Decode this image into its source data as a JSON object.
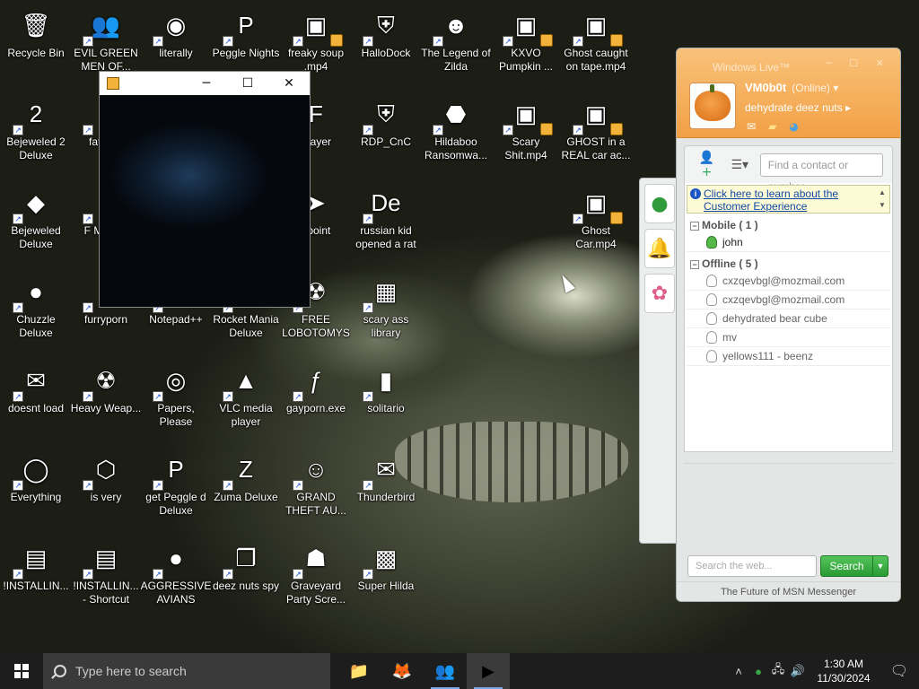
{
  "desktop": {
    "icons": [
      {
        "label": "Recycle Bin",
        "glyph": "🗑"
      },
      {
        "label": "EVIL GREEN MEN OF...",
        "glyph": "👥"
      },
      {
        "label": "literally",
        "glyph": "◉"
      },
      {
        "label": "Peggle Nights",
        "glyph": "P"
      },
      {
        "label": "freaky soup .mp4",
        "glyph": "▣"
      },
      {
        "label": "HalloDock",
        "glyph": "⛨"
      },
      {
        "label": "The Legend of Zilda",
        "glyph": "☻"
      },
      {
        "label": "KXVO Pumpkin ...",
        "glyph": "▣"
      },
      {
        "label": "Ghost caught on tape.mp4",
        "glyph": "▣"
      },
      {
        "label": "Bejeweled 2 Deluxe",
        "glyph": "2"
      },
      {
        "label": "fat lik...",
        "glyph": "▲"
      },
      {
        "label": "Player",
        "glyph": "F"
      },
      {
        "label": "RDP_CnC",
        "glyph": "⛨"
      },
      {
        "label": "Hildaboo Ransomwa...",
        "glyph": "⬣"
      },
      {
        "label": "Scary Shit.mp4",
        "glyph": "▣"
      },
      {
        "label": "GHOST in a REAL car ac...",
        "glyph": "▣"
      },
      {
        "label": "Bejeweled Deluxe",
        "glyph": "◆"
      },
      {
        "label": "F MON...",
        "glyph": "◐"
      },
      {
        "label": "npoint",
        "glyph": "➤"
      },
      {
        "label": "russian kid opened a rat",
        "glyph": "De"
      },
      {
        "label": "Ghost Car.mp4",
        "glyph": "▣"
      },
      {
        "label": "Chuzzle Deluxe",
        "glyph": "●"
      },
      {
        "label": "furryporn",
        "glyph": "◕"
      },
      {
        "label": "Notepad++",
        "glyph": "✎"
      },
      {
        "label": "Rocket Mania Deluxe",
        "glyph": "✹"
      },
      {
        "label": "FREE LOBOTOMYS",
        "glyph": "☢"
      },
      {
        "label": "scary ass library",
        "glyph": "▦"
      },
      {
        "label": "doesnt load",
        "glyph": "✉"
      },
      {
        "label": "Heavy Weap...",
        "glyph": "☢"
      },
      {
        "label": "Papers, Please",
        "glyph": "◎"
      },
      {
        "label": "VLC media player",
        "glyph": "▲"
      },
      {
        "label": "gayporn.exe",
        "glyph": "ƒ"
      },
      {
        "label": "solitario",
        "glyph": "▮"
      },
      {
        "label": "Everything",
        "glyph": "◯"
      },
      {
        "label": "is very",
        "glyph": "⬡"
      },
      {
        "label": "get Peggle d Deluxe",
        "glyph": "P"
      },
      {
        "label": "Zuma Deluxe",
        "glyph": "Z"
      },
      {
        "label": "GRAND THEFT AU...",
        "glyph": "☺"
      },
      {
        "label": "Thunderbird",
        "glyph": "✉"
      },
      {
        "label": "!INSTALLIN...",
        "glyph": "▤"
      },
      {
        "label": "!INSTALLIN... - Shortcut",
        "glyph": "▤"
      },
      {
        "label": "AGGRESSIVE AVIANS",
        "glyph": "●"
      },
      {
        "label": "deez nuts spy",
        "glyph": "❐"
      },
      {
        "label": "Graveyard Party Scre...",
        "glyph": "☗"
      },
      {
        "label": "Super Hilda",
        "glyph": "▩"
      }
    ]
  },
  "media_window": {
    "minimize": "─",
    "maximize": "☐",
    "close": "✕"
  },
  "msn": {
    "title": "Windows Live™",
    "window_buttons": "─ ☐ ✕",
    "display_name": "VM0b0t",
    "status": "(Online) ▾",
    "personal_message": "dehydrate deez nuts ▸",
    "find_placeholder": "Find a contact or number",
    "info_link": "Click here to learn about the Customer Experience",
    "groups": [
      {
        "name": "Mobile ( 1 )",
        "contacts": [
          "john"
        ]
      },
      {
        "name": "Offline ( 5 )",
        "contacts": [
          "cxzqevbgl@mozmail.com",
          "cxzqevbgl@mozmail.com",
          "dehydrated bear cube",
          "mv",
          "yellows111 - beenz"
        ]
      }
    ],
    "web_search_placeholder": "Search the web...",
    "search_button": "Search",
    "footer": "The Future of MSN Messenger",
    "colors": {
      "header": "#f2a045",
      "search_button": "#2a9a34"
    }
  },
  "taskbar": {
    "search_placeholder": "Type here to search",
    "apps": [
      {
        "name": "file-explorer-icon",
        "glyph": "📁"
      },
      {
        "name": "firefox-icon",
        "glyph": "🦊"
      },
      {
        "name": "messenger-icon",
        "glyph": "👥"
      },
      {
        "name": "media-player-icon",
        "glyph": "▶"
      }
    ],
    "time": "1:30 AM",
    "date": "11/30/2024"
  }
}
